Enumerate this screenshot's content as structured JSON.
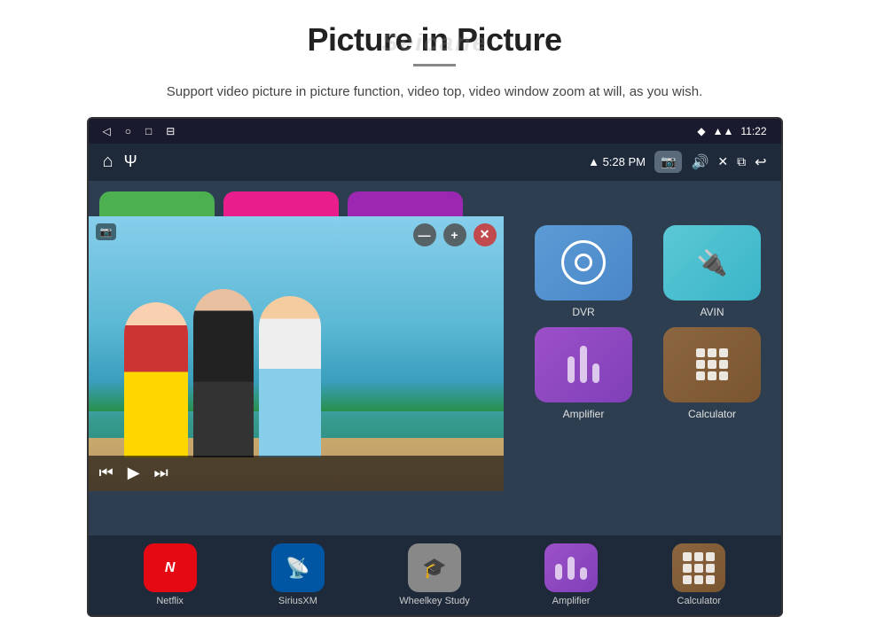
{
  "header": {
    "title": "Picture in Picture",
    "watermark": "Seicane",
    "subtitle": "Support video picture in picture function, video top, video window zoom at will, as you wish."
  },
  "statusbar": {
    "left_icons": [
      "◁",
      "○",
      "□",
      "⊟"
    ],
    "signal_icon": "▲",
    "wifi_icon": "▲",
    "time": "11:22"
  },
  "toolbar": {
    "home_icon": "⌂",
    "usb_icon": "⚡",
    "wifi_label": "▲ 5:28 PM",
    "camera_icon": "📷",
    "speaker_icon": "🔊",
    "close_icon": "✕",
    "window_icon": "⧉",
    "back_icon": "↩"
  },
  "video_pip": {
    "camera_icon": "📷",
    "minimize_label": "—",
    "expand_label": "+",
    "close_label": "✕",
    "prev_label": "⏮",
    "play_label": "▶",
    "next_label": "⏭"
  },
  "apps_right": [
    {
      "id": "dvr",
      "label": "DVR",
      "color": "dvr"
    },
    {
      "id": "avin",
      "label": "AVIN",
      "color": "avin"
    },
    {
      "id": "amplifier",
      "label": "Amplifier",
      "color": "amplifier"
    },
    {
      "id": "calculator",
      "label": "Calculator",
      "color": "calculator"
    }
  ],
  "apps_bottom": [
    {
      "id": "netflix",
      "label": "Netflix",
      "color": "netflix"
    },
    {
      "id": "siriusxm",
      "label": "SiriusXM",
      "color": "sirius"
    },
    {
      "id": "wheelkey",
      "label": "Wheelkey Study",
      "color": "wheelkey"
    },
    {
      "id": "amplifier",
      "label": "Amplifier",
      "color": "amplifier"
    },
    {
      "id": "calculator",
      "label": "Calculator",
      "color": "calculator"
    }
  ],
  "colors": {
    "background": "#ffffff",
    "tablet_bg": "#2c3e50",
    "statusbar": "#1a1a2e",
    "toolbar": "#1e2a3a"
  }
}
